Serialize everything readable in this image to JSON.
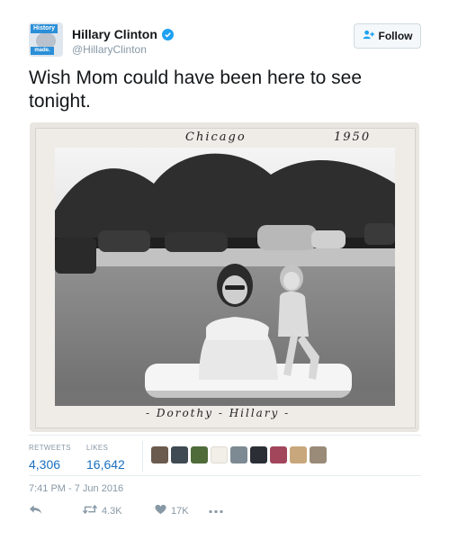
{
  "author": {
    "display_name": "Hillary Clinton",
    "handle": "@HillaryClinton",
    "avatar_text_top": "History",
    "avatar_text_bottom": "made.",
    "verified": true,
    "accent_color": "#1da1f2"
  },
  "follow_button": {
    "label": "Follow",
    "icon": "add-user-icon"
  },
  "tweet": {
    "text": "Wish Mom could have been here to see tonight."
  },
  "photo": {
    "caption_place": "Chicago",
    "caption_year": "1950",
    "caption_names": "- Dorothy - Hillary -"
  },
  "stats": {
    "retweets_label": "RETWEETS",
    "retweets_value": "4,306",
    "likes_label": "LIKES",
    "likes_value": "16,642"
  },
  "timestamp": "7:41 PM - 7 Jun 2016",
  "actions": {
    "reply_icon": "reply-icon",
    "retweet_count": "4.3K",
    "like_count": "17K",
    "more_icon": "more-icon"
  }
}
